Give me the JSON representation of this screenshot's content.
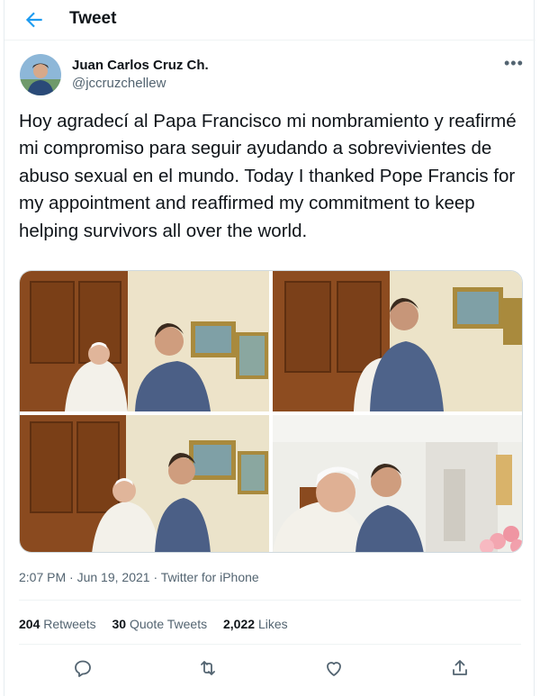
{
  "header": {
    "title": "Tweet"
  },
  "author": {
    "name": "Juan Carlos Cruz Ch.",
    "handle": "@jccruzchellew"
  },
  "tweet": {
    "text": "Hoy agradecí al Papa Francisco mi nombramiento y reafirmé mi compromiso para seguir ayudando a sobrevivientes de abuso sexual en el mundo. Today I thanked Pope Francis for my appointment and reaffirmed my commitment to keep helping survivors all over the world.",
    "time": "2:07 PM",
    "date": "Jun 19, 2021",
    "source": "Twitter for iPhone"
  },
  "stats": {
    "retweets": {
      "count": "204",
      "label": "Retweets"
    },
    "quotes": {
      "count": "30",
      "label": "Quote Tweets"
    },
    "likes": {
      "count": "2,022",
      "label": "Likes"
    }
  },
  "icons": {
    "back": "arrow-left-icon",
    "more": "more-icon",
    "reply": "reply-icon",
    "retweet": "retweet-icon",
    "like": "heart-icon",
    "share": "share-icon"
  },
  "colors": {
    "accent": "#1d9bf0",
    "secondary_text": "#536471",
    "primary_text": "#0f1419"
  }
}
